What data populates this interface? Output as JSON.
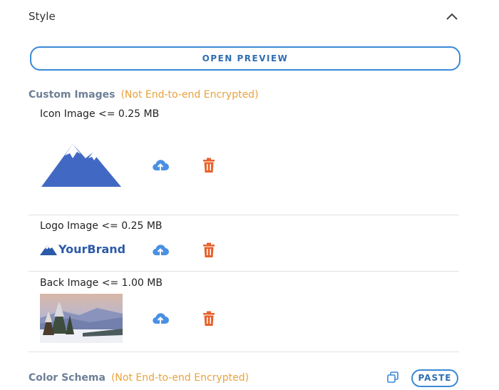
{
  "style_section": {
    "title": "Style",
    "collapse_icon": "chevron-up-icon"
  },
  "preview": {
    "label": "OPEN PREVIEW"
  },
  "custom_images": {
    "title": "Custom Images",
    "note": "(Not End-to-end Encrypted)",
    "items": [
      {
        "label": "Icon Image <= 0.25 MB",
        "upload_icon": "cloud-upload-icon",
        "delete_icon": "trash-icon"
      },
      {
        "label": "Logo Image <= 0.25 MB",
        "logo_text": "YourBrand",
        "upload_icon": "cloud-upload-icon",
        "delete_icon": "trash-icon"
      },
      {
        "label": "Back Image <= 1.00 MB",
        "upload_icon": "cloud-upload-icon",
        "delete_icon": "trash-icon"
      }
    ]
  },
  "color_schema": {
    "title": "Color Schema",
    "note": "(Not End-to-end Encrypted)",
    "copy_icon": "copy-icon",
    "paste_label": "PASTE"
  },
  "colors": {
    "accent_blue": "#3a89d6",
    "upload_blue": "#4a90e2",
    "delete_orange": "#e8622c",
    "note_orange": "#e9a23b",
    "group_title_gray": "#6e7f97",
    "brand_blue": "#2c5aa8"
  }
}
